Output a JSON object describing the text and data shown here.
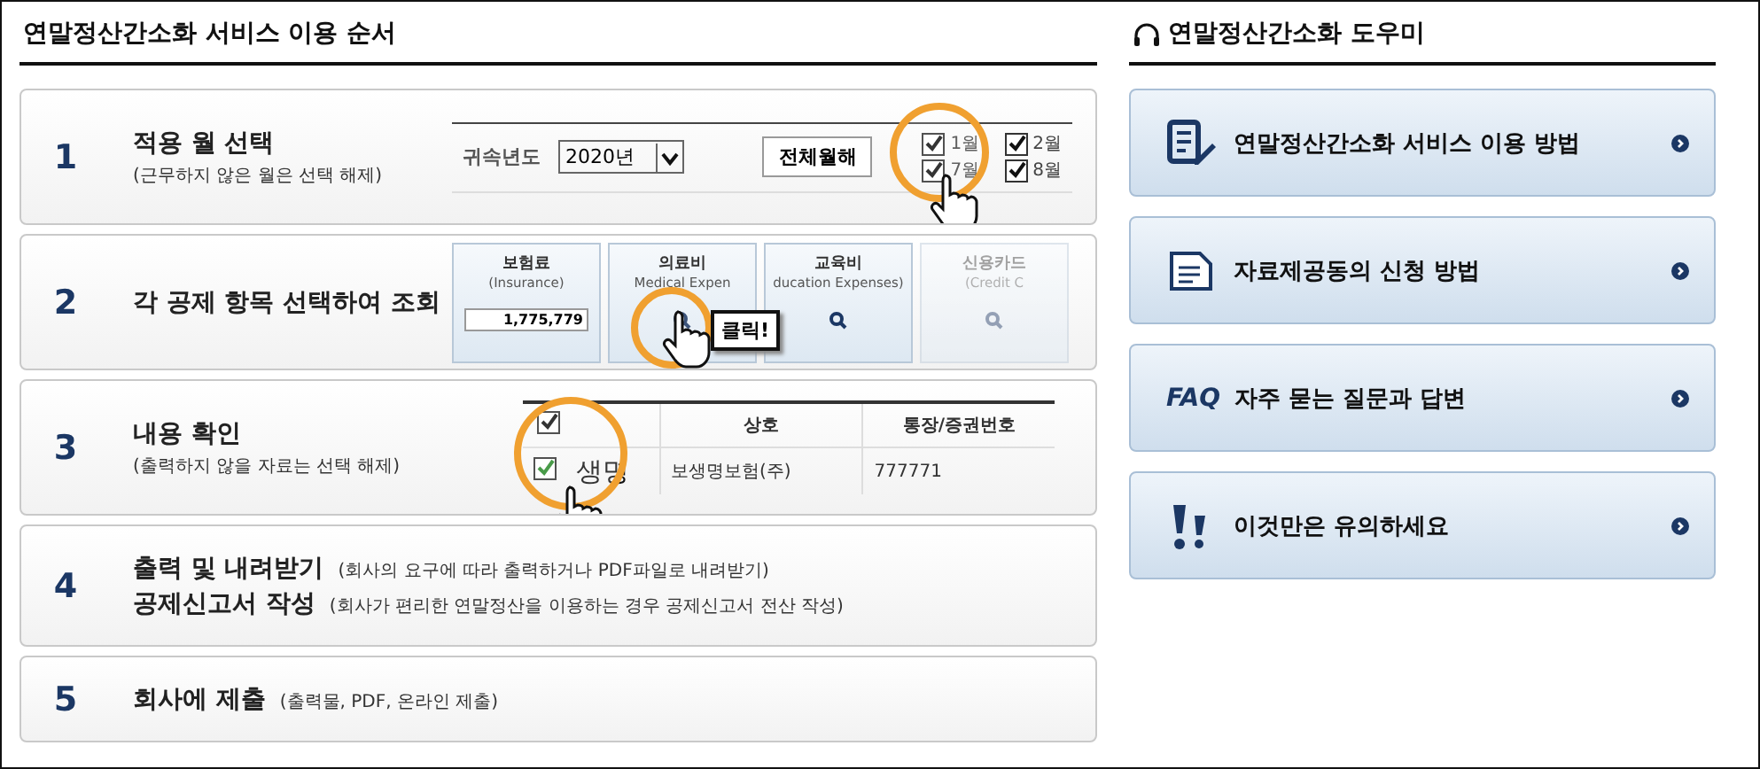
{
  "steps_title": "연말정산간소화 서비스 이용 순서",
  "steps": [
    {
      "number": "1",
      "lines": [
        {
          "title": "적용 월 선택",
          "note": "(근무하지 않은 월은 선택 해제)"
        }
      ],
      "illustration": {
        "kind": "months",
        "year_label": "귀속년도",
        "year": "2020년",
        "button": "전체월해",
        "months": [
          {
            "label": "1월",
            "checked": true
          },
          {
            "label": "7월",
            "checked": true
          },
          {
            "label": "2월",
            "checked": true
          },
          {
            "label": "8월",
            "checked": true
          }
        ]
      }
    },
    {
      "number": "2",
      "lines": [
        {
          "title": "각 공제 항목 선택하여 조회"
        }
      ],
      "illustration": {
        "kind": "categories",
        "callout": "클릭!",
        "cards": [
          {
            "title": "보험료",
            "subtitle": "(Insurance)",
            "value": "1,775,779"
          },
          {
            "title": "의료비",
            "subtitle": "Medical Expen"
          },
          {
            "title": "교육비",
            "subtitle": "ducation Expenses)"
          },
          {
            "title": "신용카드",
            "subtitle": "(Credit C"
          }
        ]
      }
    },
    {
      "number": "3",
      "lines": [
        {
          "title": "내용 확인",
          "note": "(출력하지 않을 자료는 선택 해제)"
        }
      ],
      "illustration": {
        "kind": "table",
        "header_checked": true,
        "columns": [
          "상호",
          "통장/증권번호"
        ],
        "magnified": "생명",
        "rows": [
          {
            "checked": true,
            "cells": [
              "보생명보험(주)",
              "777771"
            ]
          }
        ]
      }
    },
    {
      "number": "4",
      "lines": [
        {
          "title": "출력 및 내려받기",
          "note": "(회사의 요구에 따라 출력하거나 PDF파일로 내려받기)"
        },
        {
          "title": "공제신고서 작성",
          "note": "(회사가 편리한 연말정산을 이용하는 경우 공제신고서 전산 작성)"
        }
      ]
    },
    {
      "number": "5",
      "lines": [
        {
          "title": "회사에 제출",
          "note": "(출력물, PDF, 온라인 제출)"
        }
      ]
    }
  ],
  "helper_title": "연말정산간소화 도우미",
  "helper_items": [
    {
      "kind": "document-pen",
      "label": "연말정산간소화 서비스 이용 방법"
    },
    {
      "kind": "document",
      "label": "자료제공동의 신청 방법"
    },
    {
      "kind": "faq",
      "prefix": "FAQ",
      "label": "자주 묻는 질문과 답변"
    },
    {
      "kind": "alert",
      "label": "이것만은 유의하세요"
    }
  ]
}
